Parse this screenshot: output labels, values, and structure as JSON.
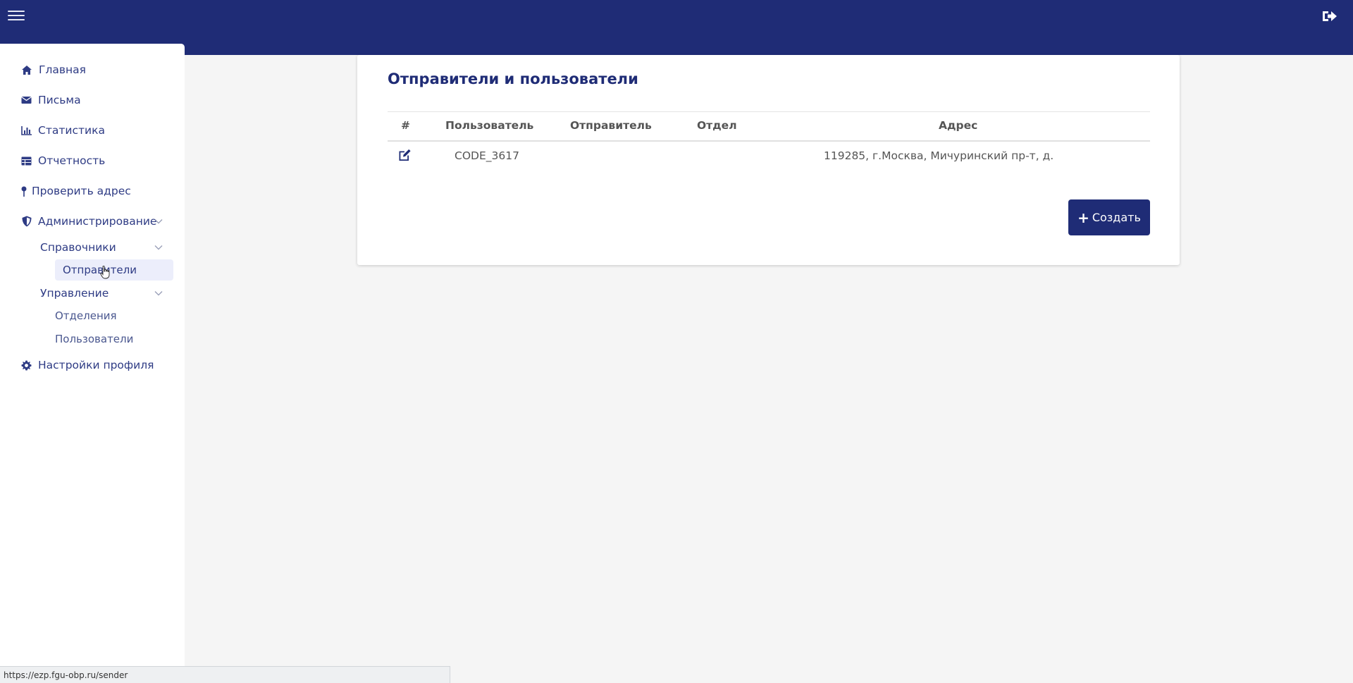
{
  "header": {
    "menu_icon": "hamburger-icon",
    "logout_icon": "sign-out-icon",
    "bg_color": "#1f2c76"
  },
  "sidebar": {
    "items": [
      {
        "label": "Главная",
        "icon": "home-icon"
      },
      {
        "label": "Письма",
        "icon": "envelope-icon"
      },
      {
        "label": "Статистика",
        "icon": "bar-chart-icon"
      },
      {
        "label": "Отчетность",
        "icon": "table-icon"
      },
      {
        "label": "Проверить адрес",
        "icon": "map-pin-icon"
      },
      {
        "label": "Администрирование",
        "icon": "shield-icon",
        "expanded": true
      },
      {
        "label": "Настройки профиля",
        "icon": "gear-icon"
      }
    ],
    "admin": {
      "reference": {
        "label": "Справочники",
        "items": [
          {
            "label": "Отправители",
            "active": true
          }
        ]
      },
      "management": {
        "label": "Управление",
        "items": [
          {
            "label": "Отделения"
          },
          {
            "label": "Пользователи"
          }
        ]
      }
    }
  },
  "main": {
    "title": "Отправители и пользователи",
    "table": {
      "columns": [
        "#",
        "Пользователь",
        "Отправитель",
        "Отдел",
        "Адрес"
      ],
      "rows": [
        {
          "action_icon": "edit-icon",
          "user": "CODE_3617",
          "sender": "",
          "department": "",
          "address": "119285, г.Москва, Мичуринский пр-т, д."
        }
      ]
    },
    "create_button": "Создать"
  },
  "statusbar": {
    "url": "https://ezp.fgu-obp.ru/sender"
  }
}
